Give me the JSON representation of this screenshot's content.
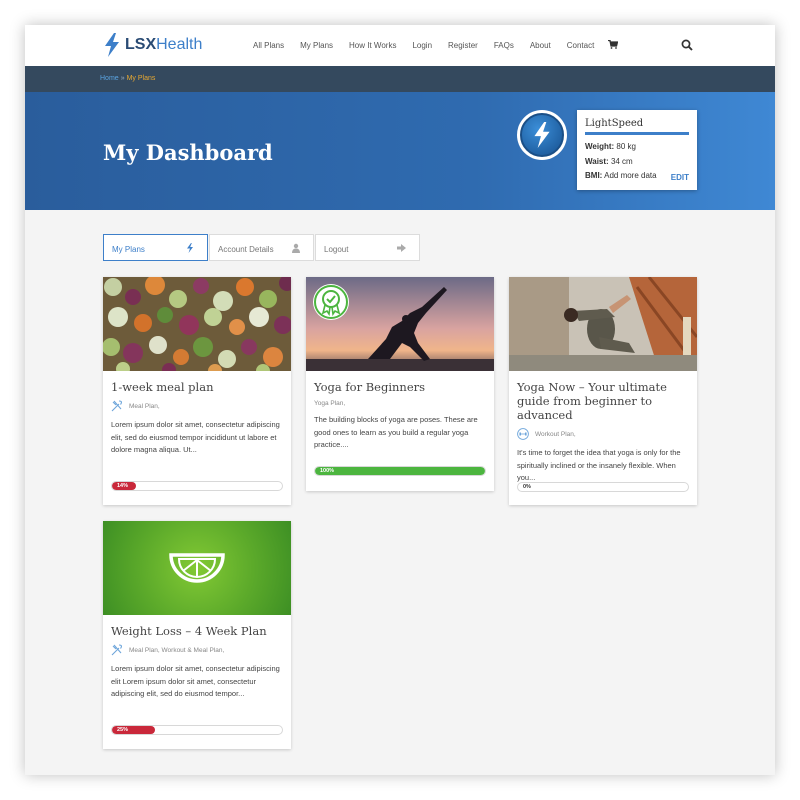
{
  "brand": {
    "name_bold": "LSX",
    "name_rest": "Health"
  },
  "nav": [
    "All Plans",
    "My Plans",
    "How It Works",
    "Login",
    "Register",
    "FAQs",
    "About",
    "Contact"
  ],
  "breadcrumb": {
    "home": "Home",
    "separator": "»",
    "current": "My Plans"
  },
  "hero": {
    "title": "My Dashboard"
  },
  "profile": {
    "name": "LightSpeed",
    "weight_label": "Weight:",
    "weight_value": "80 kg",
    "waist_label": "Waist:",
    "waist_value": "34 cm",
    "bmi_label": "BMI:",
    "bmi_value": "Add more data",
    "edit_label": "EDIT"
  },
  "tabs": [
    {
      "label": "My Plans",
      "icon": "bolt-icon"
    },
    {
      "label": "Account Details",
      "icon": "user-icon"
    },
    {
      "label": "Logout",
      "icon": "sign-out-icon"
    }
  ],
  "cards": [
    {
      "title": "1-week meal plan",
      "meta": "Meal Plan,",
      "meta_icon": "utensils-icon",
      "desc": "Lorem ipsum dolor sit amet, consectetur adipiscing elit, sed do eiusmod tempor incididunt ut labore et dolore magna aliqua. Ut...",
      "progress": 14,
      "progress_label": "14%",
      "image": "mixed-vegetables-photo"
    },
    {
      "title": "Yoga for Beginners",
      "meta": "Yoga Plan,",
      "meta_icon": "",
      "desc": "The building blocks of yoga are poses. These are good ones to learn as you build a regular yoga practice....",
      "progress": 100,
      "progress_label": "100%",
      "image": "yoga-sunset-photo",
      "badge": "completed-badge-icon"
    },
    {
      "title": "Yoga Now – Your ultimate guide from beginner to advanced",
      "meta": "Workout Plan,",
      "meta_icon": "dumbbell-icon",
      "desc": "It's time to forget the idea that yoga is only for the spiritually inclined or the insanely flexible. When you...",
      "progress": 0,
      "progress_label": "0%",
      "image": "yoga-pose-photo"
    },
    {
      "title": "Weight Loss – 4 Week Plan",
      "meta": "Meal Plan, Workout & Meal Plan,",
      "meta_icon": "utensils-icon",
      "desc": "Lorem ipsum dolor sit amet, consectetur adipiscing elit Lorem ipsum dolor sit amet, consectetur adipiscing elit, sed do eiusmod tempor...",
      "progress": 25,
      "progress_label": "25%",
      "image": "lime-slice-graphic"
    }
  ],
  "colors": {
    "accent": "#3d7fc9",
    "progress_low": "#c9283a",
    "progress_done": "#4cb53f",
    "header_dark": "#34495e"
  }
}
